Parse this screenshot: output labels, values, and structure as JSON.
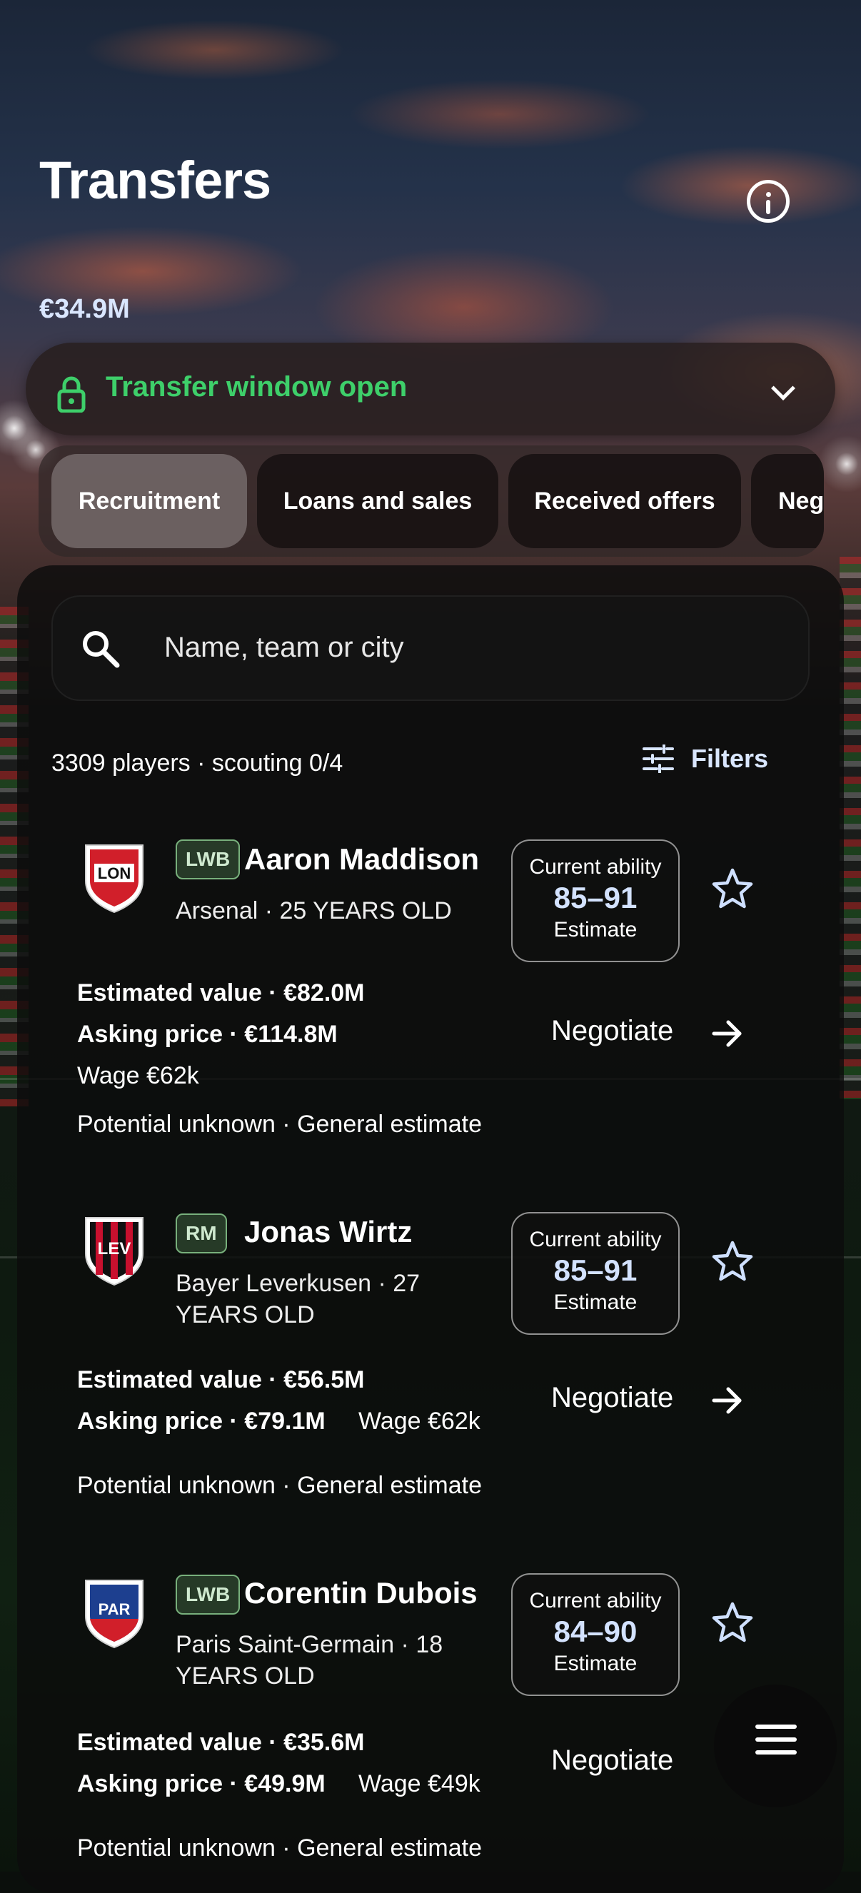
{
  "header": {
    "title": "Transfers",
    "budget": "€34.9M",
    "window_status": "Transfer window open"
  },
  "tabs": [
    {
      "label": "Recruitment",
      "active": true
    },
    {
      "label": "Loans and sales",
      "active": false
    },
    {
      "label": "Received offers",
      "active": false
    },
    {
      "label": "Neg",
      "active": false
    }
  ],
  "search": {
    "placeholder": "Name, team or city",
    "value": ""
  },
  "results": {
    "count_text": "3309 players · scouting 0/4",
    "filters_label": "Filters"
  },
  "players": [
    {
      "crest": "LON",
      "crest_colors": [
        "#d11f2a",
        "#ffffff"
      ],
      "position": "LWB",
      "name": "Aaron Maddison",
      "meta_line1": "Arsenal · 25 YEARS OLD",
      "meta_line2": "",
      "ability_label": "Current ability",
      "ability_range": "85–91",
      "ability_note": "Estimate",
      "estimated_value": "Estimated value · €82.0M",
      "asking_price": "Asking price · €114.8M",
      "wage": "Wage €62k",
      "potential": "Potential unknown · General estimate",
      "action": "Negotiate"
    },
    {
      "crest": "LEV",
      "crest_colors": [
        "#c8102e",
        "#111111"
      ],
      "position": "RM",
      "name": "Jonas Wirtz",
      "meta_line1": "Bayer Leverkusen · 27",
      "meta_line2": "YEARS OLD",
      "ability_label": "Current ability",
      "ability_range": "85–91",
      "ability_note": "Estimate",
      "estimated_value": "Estimated value · €56.5M",
      "asking_price": "Asking price · €79.1M",
      "wage": "Wage €62k",
      "potential": "Potential unknown · General estimate",
      "action": "Negotiate"
    },
    {
      "crest": "PAR",
      "crest_colors": [
        "#1d3f8f",
        "#d11f2a"
      ],
      "position": "LWB",
      "name": "Corentin Dubois",
      "meta_line1": "Paris Saint-Germain · 18",
      "meta_line2": "YEARS OLD",
      "ability_label": "Current ability",
      "ability_range": "84–90",
      "ability_note": "Estimate",
      "estimated_value": "Estimated value · €35.6M",
      "asking_price": "Asking price · €49.9M",
      "wage": "Wage €49k",
      "potential": "Potential unknown · General estimate",
      "action": "Negotiate"
    }
  ],
  "colors": {
    "accent_green": "#3ecf6a",
    "accent_blue": "#d9e6ff",
    "badge_green": "#78b07c"
  },
  "icons": [
    "info-icon",
    "lock-icon",
    "chevron-down-icon",
    "search-icon",
    "sliders-icon",
    "star-icon",
    "arrow-right-icon",
    "menu-icon"
  ]
}
